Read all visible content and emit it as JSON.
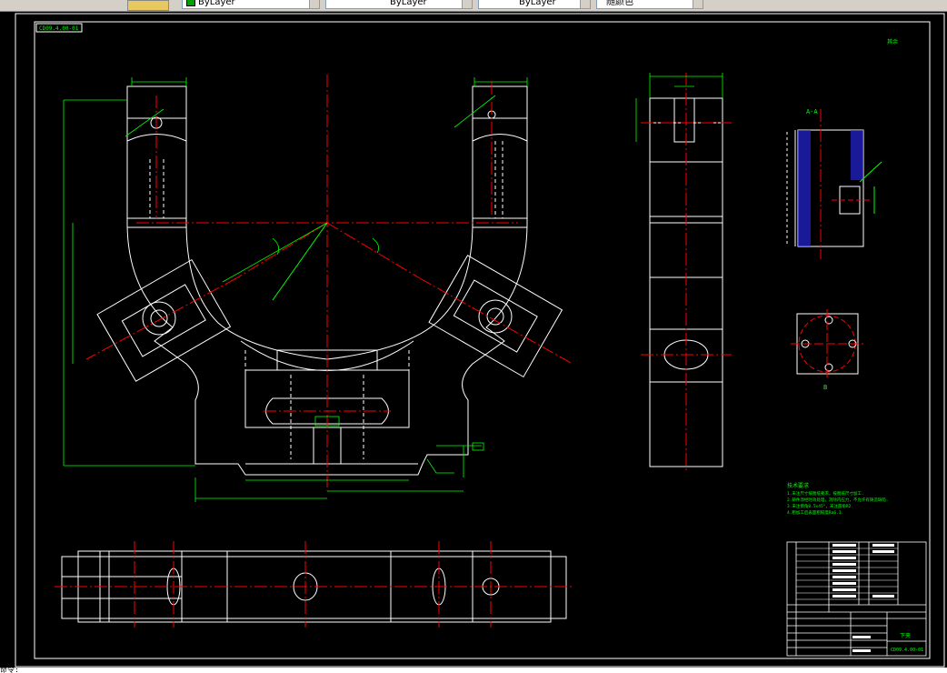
{
  "toolbar": {
    "color_value": "ByLayer",
    "linetype_value": "ByLayer",
    "lineweight_value": "ByLayer",
    "plotstyle_value": "随颜色"
  },
  "drawing": {
    "drawing_number": "CD09.4.00-01",
    "title_block_name": "下夹",
    "title_block_number": "CD09.4.00-01",
    "roughness_note": "其余",
    "tech_requirements_title": "技术要求",
    "tech_requirements": [
      "1.未注尺寸按图纸要求，按图纸尺寸加工.",
      "2.铸件须经时效处理，消除内应力，不允许有铸造缺陷.",
      "3.未注倒角0.5x45°，未注圆角R2.",
      "4.粗加工后表面粗糙度Ra6.3."
    ],
    "section_label": "A-A",
    "view_label": "B"
  },
  "colors": {
    "background": "#000000",
    "outline": "#ffffff",
    "center_line": "#ff0000",
    "dimension": "#00ff00",
    "hatch": "#2b2bff",
    "toolbar": "#d4d0c8"
  },
  "command_line": "命令:"
}
